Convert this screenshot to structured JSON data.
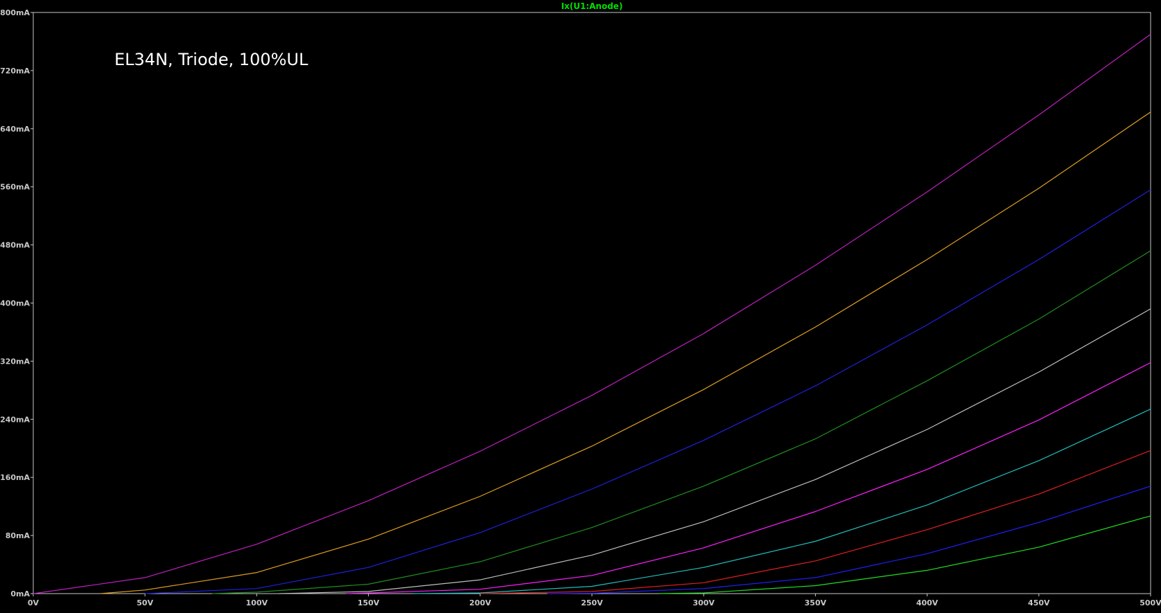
{
  "chart_data": {
    "type": "line",
    "title": "Ix(U1:Anode)",
    "annotation": "EL34N, Triode, 100%UL",
    "xlabel": "",
    "ylabel": "",
    "xlim": [
      0,
      500
    ],
    "ylim": [
      0,
      800
    ],
    "x_unit": "V",
    "y_unit": "mA",
    "x_ticks": [
      0,
      50,
      100,
      150,
      200,
      250,
      300,
      350,
      400,
      450,
      500
    ],
    "y_ticks": [
      0,
      80,
      160,
      240,
      320,
      400,
      480,
      560,
      640,
      720,
      800
    ],
    "x_tick_labels": [
      "0V",
      "50V",
      "100V",
      "150V",
      "200V",
      "250V",
      "300V",
      "350V",
      "400V",
      "450V",
      "500V"
    ],
    "y_tick_labels": [
      "0mA",
      "80mA",
      "160mA",
      "240mA",
      "320mA",
      "400mA",
      "480mA",
      "560mA",
      "640mA",
      "720mA",
      "800mA"
    ],
    "grid": false,
    "legend": "none",
    "colors": {
      "background": "#000000",
      "axes": "#c8c8c8",
      "tick_labels": "#c8c8c8",
      "title": "#00e000",
      "annotation": "#ffffff"
    },
    "series": [
      {
        "color": "#c020c0",
        "x": [
          0,
          50,
          100,
          150,
          200,
          250,
          300,
          350,
          400,
          450,
          500
        ],
        "y": [
          0,
          22,
          68,
          128,
          196,
          273,
          358,
          452,
          553,
          659,
          770
        ]
      },
      {
        "color": "#e0a020",
        "x": [
          30,
          50,
          100,
          150,
          200,
          250,
          300,
          350,
          400,
          450,
          500
        ],
        "y": [
          0,
          5,
          29,
          75,
          134,
          203,
          281,
          367,
          460,
          558,
          663
        ]
      },
      {
        "color": "#2020e0",
        "x": [
          50,
          100,
          150,
          200,
          250,
          300,
          350,
          400,
          450,
          500
        ],
        "y": [
          0,
          7,
          36,
          84,
          144,
          211,
          286,
          370,
          460,
          556
        ]
      },
      {
        "color": "#209020",
        "x": [
          80,
          100,
          150,
          200,
          250,
          300,
          350,
          400,
          450,
          500
        ],
        "y": [
          0,
          2,
          13,
          44,
          91,
          148,
          213,
          293,
          378,
          472
        ]
      },
      {
        "color": "#c0c0c0",
        "x": [
          110,
          150,
          200,
          250,
          300,
          350,
          400,
          450,
          500
        ],
        "y": [
          0,
          3,
          19,
          53,
          99,
          157,
          226,
          305,
          392
        ]
      },
      {
        "color": "#ff20ff",
        "x": [
          140,
          150,
          200,
          250,
          300,
          350,
          400,
          450,
          500
        ],
        "y": [
          0,
          1,
          6,
          25,
          63,
          113,
          171,
          239,
          318
        ]
      },
      {
        "color": "#20c0c0",
        "x": [
          170,
          200,
          250,
          300,
          350,
          400,
          450,
          500
        ],
        "y": [
          0,
          1,
          10,
          36,
          72,
          122,
          183,
          254
        ]
      },
      {
        "color": "#e02020",
        "x": [
          200,
          250,
          300,
          350,
          400,
          450,
          500
        ],
        "y": [
          0,
          3,
          15,
          45,
          88,
          137,
          197
        ]
      },
      {
        "color": "#2020ff",
        "x": [
          230,
          250,
          300,
          350,
          400,
          450,
          500
        ],
        "y": [
          0,
          0.5,
          7,
          22,
          55,
          98,
          148
        ]
      },
      {
        "color": "#20e020",
        "x": [
          280,
          300,
          350,
          400,
          450,
          500
        ],
        "y": [
          0,
          1,
          11,
          32,
          64,
          107
        ]
      }
    ]
  }
}
